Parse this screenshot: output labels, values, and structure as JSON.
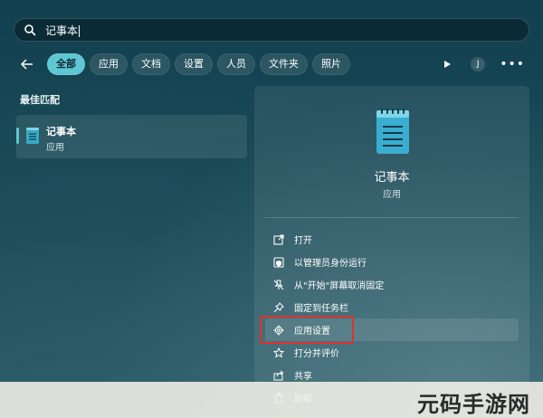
{
  "search": {
    "query": "记事本"
  },
  "filters": {
    "items": [
      {
        "label": "全部",
        "active": true
      },
      {
        "label": "应用",
        "active": false
      },
      {
        "label": "文档",
        "active": false
      },
      {
        "label": "设置",
        "active": false
      },
      {
        "label": "人员",
        "active": false
      },
      {
        "label": "文件夹",
        "active": false
      },
      {
        "label": "照片",
        "active": false
      }
    ],
    "avatar_initial": "J",
    "more_label": "•••"
  },
  "best_match": {
    "title": "最佳匹配",
    "app_name": "记事本",
    "app_type": "应用"
  },
  "preview": {
    "app_name": "记事本",
    "app_type": "应用",
    "actions": [
      {
        "label": "打开",
        "icon": "open-external-icon"
      },
      {
        "label": "以管理员身份运行",
        "icon": "run-as-admin-icon"
      },
      {
        "label": "从\"开始\"屏幕取消固定",
        "icon": "unpin-icon"
      },
      {
        "label": "固定到任务栏",
        "icon": "pin-icon"
      },
      {
        "label": "应用设置",
        "icon": "gear-icon"
      },
      {
        "label": "打分并评价",
        "icon": "star-icon"
      },
      {
        "label": "共享",
        "icon": "share-icon"
      },
      {
        "label": "卸载",
        "icon": "trash-icon"
      }
    ]
  },
  "colors": {
    "accent": "#5fc6d3",
    "highlight_box": "#e0332d",
    "background": "#0f3a47"
  },
  "watermark": {
    "text": "元码手游网"
  }
}
